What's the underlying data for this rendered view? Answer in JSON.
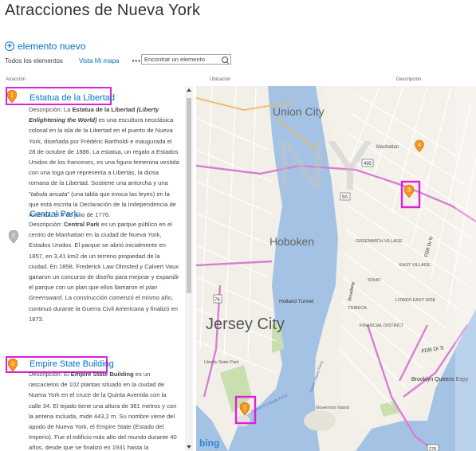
{
  "page": {
    "title": "Atracciones de Nueva York",
    "new_item_label": "elemento nuevo",
    "toolbar": {
      "view_all": "Todos los elementos",
      "view_map": "Vista Mi mapa",
      "more": "•••",
      "search_placeholder": "Encontrar un elemento"
    },
    "columns": {
      "attraction": "Atracción",
      "location": "Ubicación",
      "description": "Descripción"
    }
  },
  "items": [
    {
      "pin": "1",
      "pin_color": "#f7941d",
      "title": "Estatua de la Libertad",
      "desc_label": "Descripción:",
      "desc_html": "La <b>Estatua de la Libertad</b> <b><i>(Liberty Enlightening the World)</i></b> es una escultura neoclásica colosal en la isla de la Libertad en el puerto de Nueva York, diseñada por Frédéric Bartholdi e inaugurada el 28 de octubre de 1886. La estatua, un regalo a Estados Unidos de los franceses, es una figura femenina vestida con una toga que representa a Libertas, la diosa romana de la Libertad. Sostiene una antorcha y una \"<i>tabula ansata</i>\" (una tabla que evoca las leyes) en la que está escrita la Declaración de la Independencia de América, el 4 de julio de 1776."
    },
    {
      "pin": "2",
      "pin_color": "#a0a0a0",
      "title": "Central Park",
      "desc_label": "Descripción:",
      "desc_html": "<b>Central Park</b> es un parque público en el centro de Manhattan en la ciudad de Nueva York, Estados Unidos. El parque se abrió inicialmente en 1857, en 3,41 km2 de un terreno propiedad de la ciudad. En 1858, Frederick Law Olmsted y Calvert Vaux ganaron un concurso de diseño para mejorar y expandir el parque con un plan que ellos llamaron el <i>plan Greensward</i>. La construcción comenzó el mismo año, continuó durante la Guerra Civil Americana y finalizó en 1873."
    },
    {
      "pin": "3",
      "pin_color": "#f7941d",
      "title": "Empire State Building",
      "desc_label": "Descripción:",
      "desc_html": "El <b>Empire State Building</b> es un rascacielos de 102 plantas situado en la ciudad de Nueva York en el cruce de la Quinta Avenida con la calle 34. El tejado tiene una altura de 381 metros y con la antena incluida, mide 443,2 m. Su nombre viene del apodo de Nueva York, el Empire State (Estado del Imperio). Fue el edificio más alto del mundo durante 40 años, desde que se finalizó en 1931 hasta la construcción del"
    }
  ],
  "map": {
    "labels": {
      "union_city": "Union City",
      "hoboken": "Hoboken",
      "jersey_city": "Jersey City",
      "manhattan": "Manhattan",
      "bing": "bing",
      "fdr": "FDR Dr S",
      "fdr2": "FDR Dr N",
      "holland": "Holland Tunnel",
      "brooklyn_queens": "Brooklyn Queens Expy",
      "governors": "Governors Island",
      "liberty_state_park": "Liberty State Park",
      "east_village": "EAST VILLAGE",
      "greenwich": "GREENWICH VILLAGE",
      "tribeca": "TRIBECA",
      "fin_dist": "FINANCIAL DISTRICT",
      "soho": "SOHO",
      "lower_east": "LOWER EAST SIDE",
      "statue_ferry": "Statue of Liberty Ferry",
      "staten_ferry": "Staten Island Ferry",
      "route_495": "495",
      "route_9a": "9A",
      "route_278": "278",
      "route_78": "78",
      "broadway": "Broadway",
      "nyw": "NY"
    },
    "pins": [
      {
        "label": "1",
        "color": "#f7941d"
      },
      {
        "label": "3",
        "color": "#f7941d"
      },
      {
        "label": "4",
        "color": "#f7941d"
      }
    ]
  }
}
